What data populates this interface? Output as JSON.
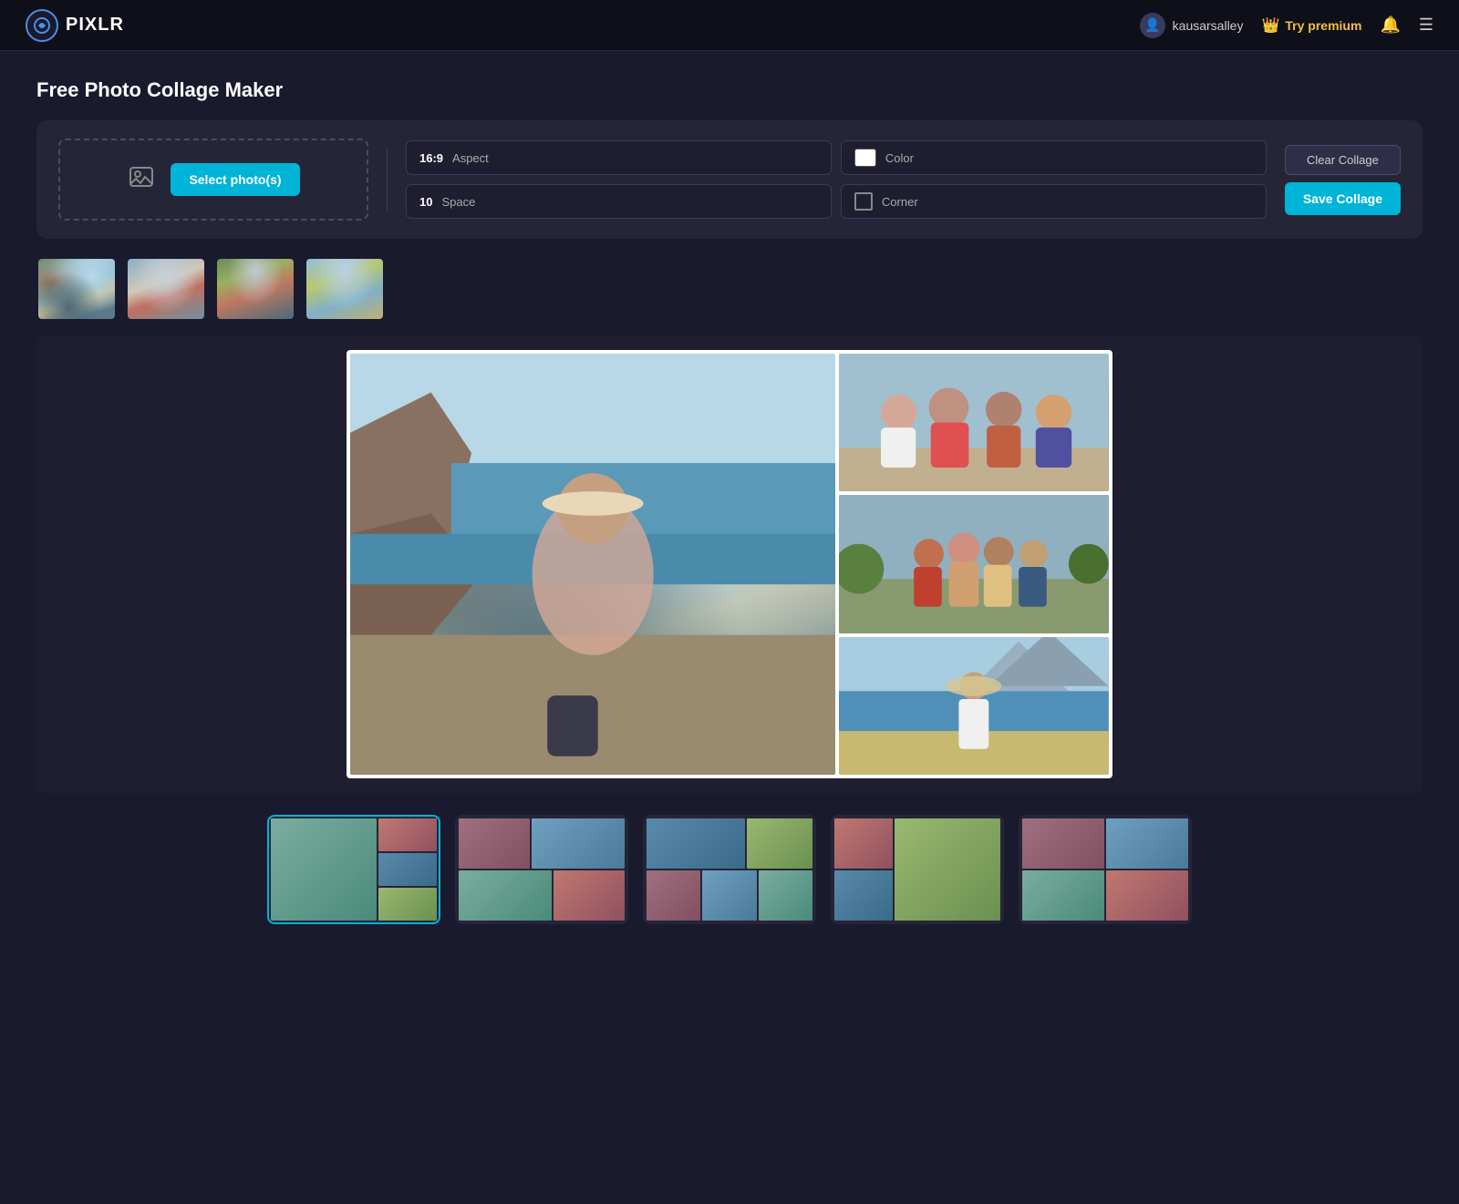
{
  "app": {
    "name": "PIXLR",
    "logo_char": "P"
  },
  "navbar": {
    "username": "kausarsalley",
    "premium_label": "Try premium",
    "bell_char": "🔔",
    "menu_char": "☰"
  },
  "page": {
    "title": "Free Photo Collage Maker"
  },
  "upload": {
    "select_btn": "Select photo(s)"
  },
  "options": {
    "aspect_value": "16:9",
    "aspect_label": "Aspect",
    "color_label": "Color",
    "space_value": "10",
    "space_label": "Space",
    "corner_label": "Corner"
  },
  "actions": {
    "clear_label": "Clear Collage",
    "save_label": "Save Collage"
  },
  "templates": [
    {
      "id": 1,
      "layout": "1-left-3-right"
    },
    {
      "id": 2,
      "layout": "2-top-2-bottom"
    },
    {
      "id": 3,
      "layout": "3-top-2-bottom"
    },
    {
      "id": 4,
      "layout": "1-big-2-small"
    },
    {
      "id": 5,
      "layout": "4-equal"
    }
  ]
}
